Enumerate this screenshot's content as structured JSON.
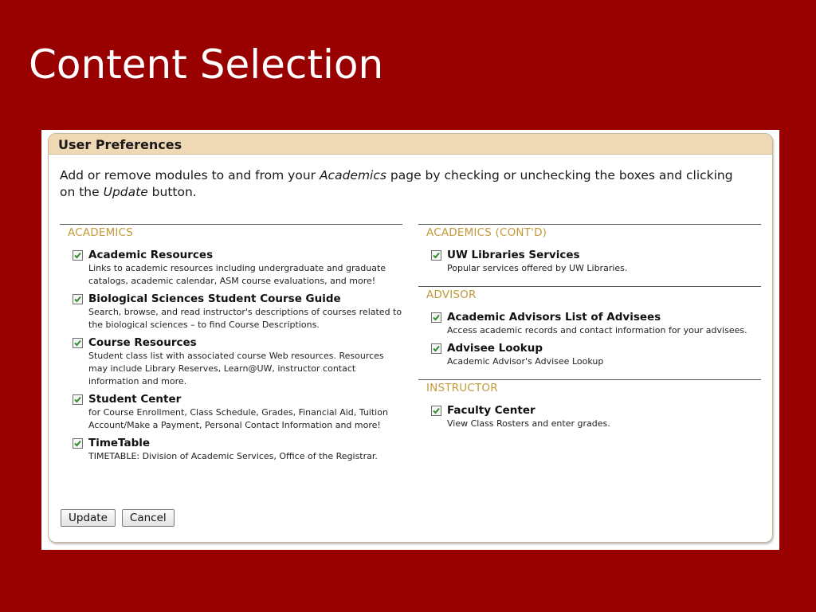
{
  "slide": {
    "title": "Content Selection"
  },
  "panel": {
    "header": "User Preferences",
    "intro": {
      "part1": "Add or remove modules to and from your ",
      "em1": "Academics",
      "part2": " page by checking or unchecking the boxes and clicking on the ",
      "em2": "Update",
      "part3": " button."
    }
  },
  "sections": {
    "academics": {
      "title": "ACADEMICS",
      "items": [
        {
          "title": "Academic Resources",
          "desc": "Links to academic resources including undergraduate and graduate catalogs, academic calendar, ASM course evaluations, and more!",
          "checked": true
        },
        {
          "title": "Biological Sciences Student Course Guide",
          "desc": "Search, browse, and read instructor's descriptions of courses related to the biological sciences – to find Course Descriptions.",
          "checked": true
        },
        {
          "title": "Course Resources",
          "desc": "Student class list with associated course Web resources. Resources may include Library Reserves, Learn@UW, instructor contact information and more.",
          "checked": true
        },
        {
          "title": "Student Center",
          "desc": "for Course Enrollment, Class Schedule, Grades, Financial Aid, Tuition Account/Make a Payment, Personal Contact Information and more!",
          "checked": true
        },
        {
          "title": "TimeTable",
          "desc": "TIMETABLE: Division of Academic Services, Office of the Registrar.",
          "checked": true
        }
      ]
    },
    "academics_contd": {
      "title": "ACADEMICS (CONT'D)",
      "items": [
        {
          "title": "UW Libraries Services",
          "desc": "Popular services offered by UW Libraries.",
          "checked": true
        }
      ]
    },
    "advisor": {
      "title": "ADVISOR",
      "items": [
        {
          "title": "Academic Advisors List of Advisees",
          "desc": "Access academic records and contact information for your advisees.",
          "checked": true
        },
        {
          "title": "Advisee Lookup",
          "desc": "Academic Advisor's Advisee Lookup",
          "checked": true
        }
      ]
    },
    "instructor": {
      "title": "INSTRUCTOR",
      "items": [
        {
          "title": "Faculty Center",
          "desc": "View Class Rosters and enter grades.",
          "checked": true
        }
      ]
    }
  },
  "buttons": {
    "update": "Update",
    "cancel": "Cancel"
  },
  "colors": {
    "background": "#990000",
    "header": "#eed9b4",
    "section_title": "#c29a3a",
    "check": "#2e8b2e"
  },
  "icons": {
    "checkbox": "checkmark-icon"
  }
}
